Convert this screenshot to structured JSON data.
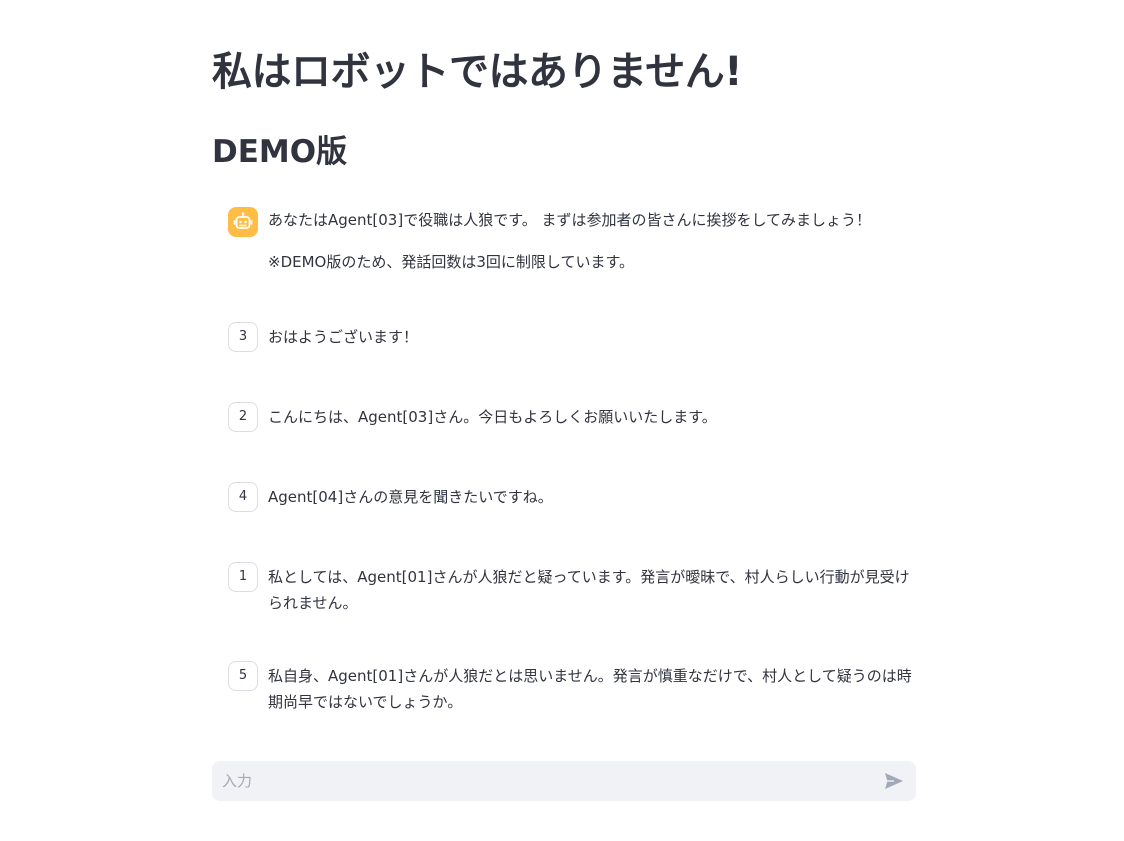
{
  "header": {
    "title": "私はロボットではありません!",
    "subtitle": "DEMO版"
  },
  "messages": [
    {
      "avatar": "bot-icon",
      "lines": [
        "あなたはAgent[03]で役職は人狼です。 まずは参加者の皆さんに挨拶をしてみましょう！",
        "※DEMO版のため、発話回数は3回に制限しています。"
      ]
    },
    {
      "avatar": "3",
      "text": "おはようございます！"
    },
    {
      "avatar": "2",
      "text": "こんにちは、Agent[03]さん。今日もよろしくお願いいたします。"
    },
    {
      "avatar": "4",
      "text": "Agent[04]さんの意見を聞きたいですね。"
    },
    {
      "avatar": "1",
      "text": "私としては、Agent[01]さんが人狼だと疑っています。発言が曖昧で、村人らしい行動が見受けられません。"
    },
    {
      "avatar": "5",
      "text": "私自身、Agent[01]さんが人狼だとは思いません。発言が慎重なだけで、村人として疑うのは時期尚早ではないでしょうか。"
    }
  ],
  "chat_input": {
    "placeholder": "入力",
    "value": "",
    "send_icon": "send-icon"
  },
  "colors": {
    "bot_avatar": "#ffbd45",
    "text": "#31333f",
    "input_background": "#f0f2f6",
    "send_icon": "#a3a8b8"
  }
}
